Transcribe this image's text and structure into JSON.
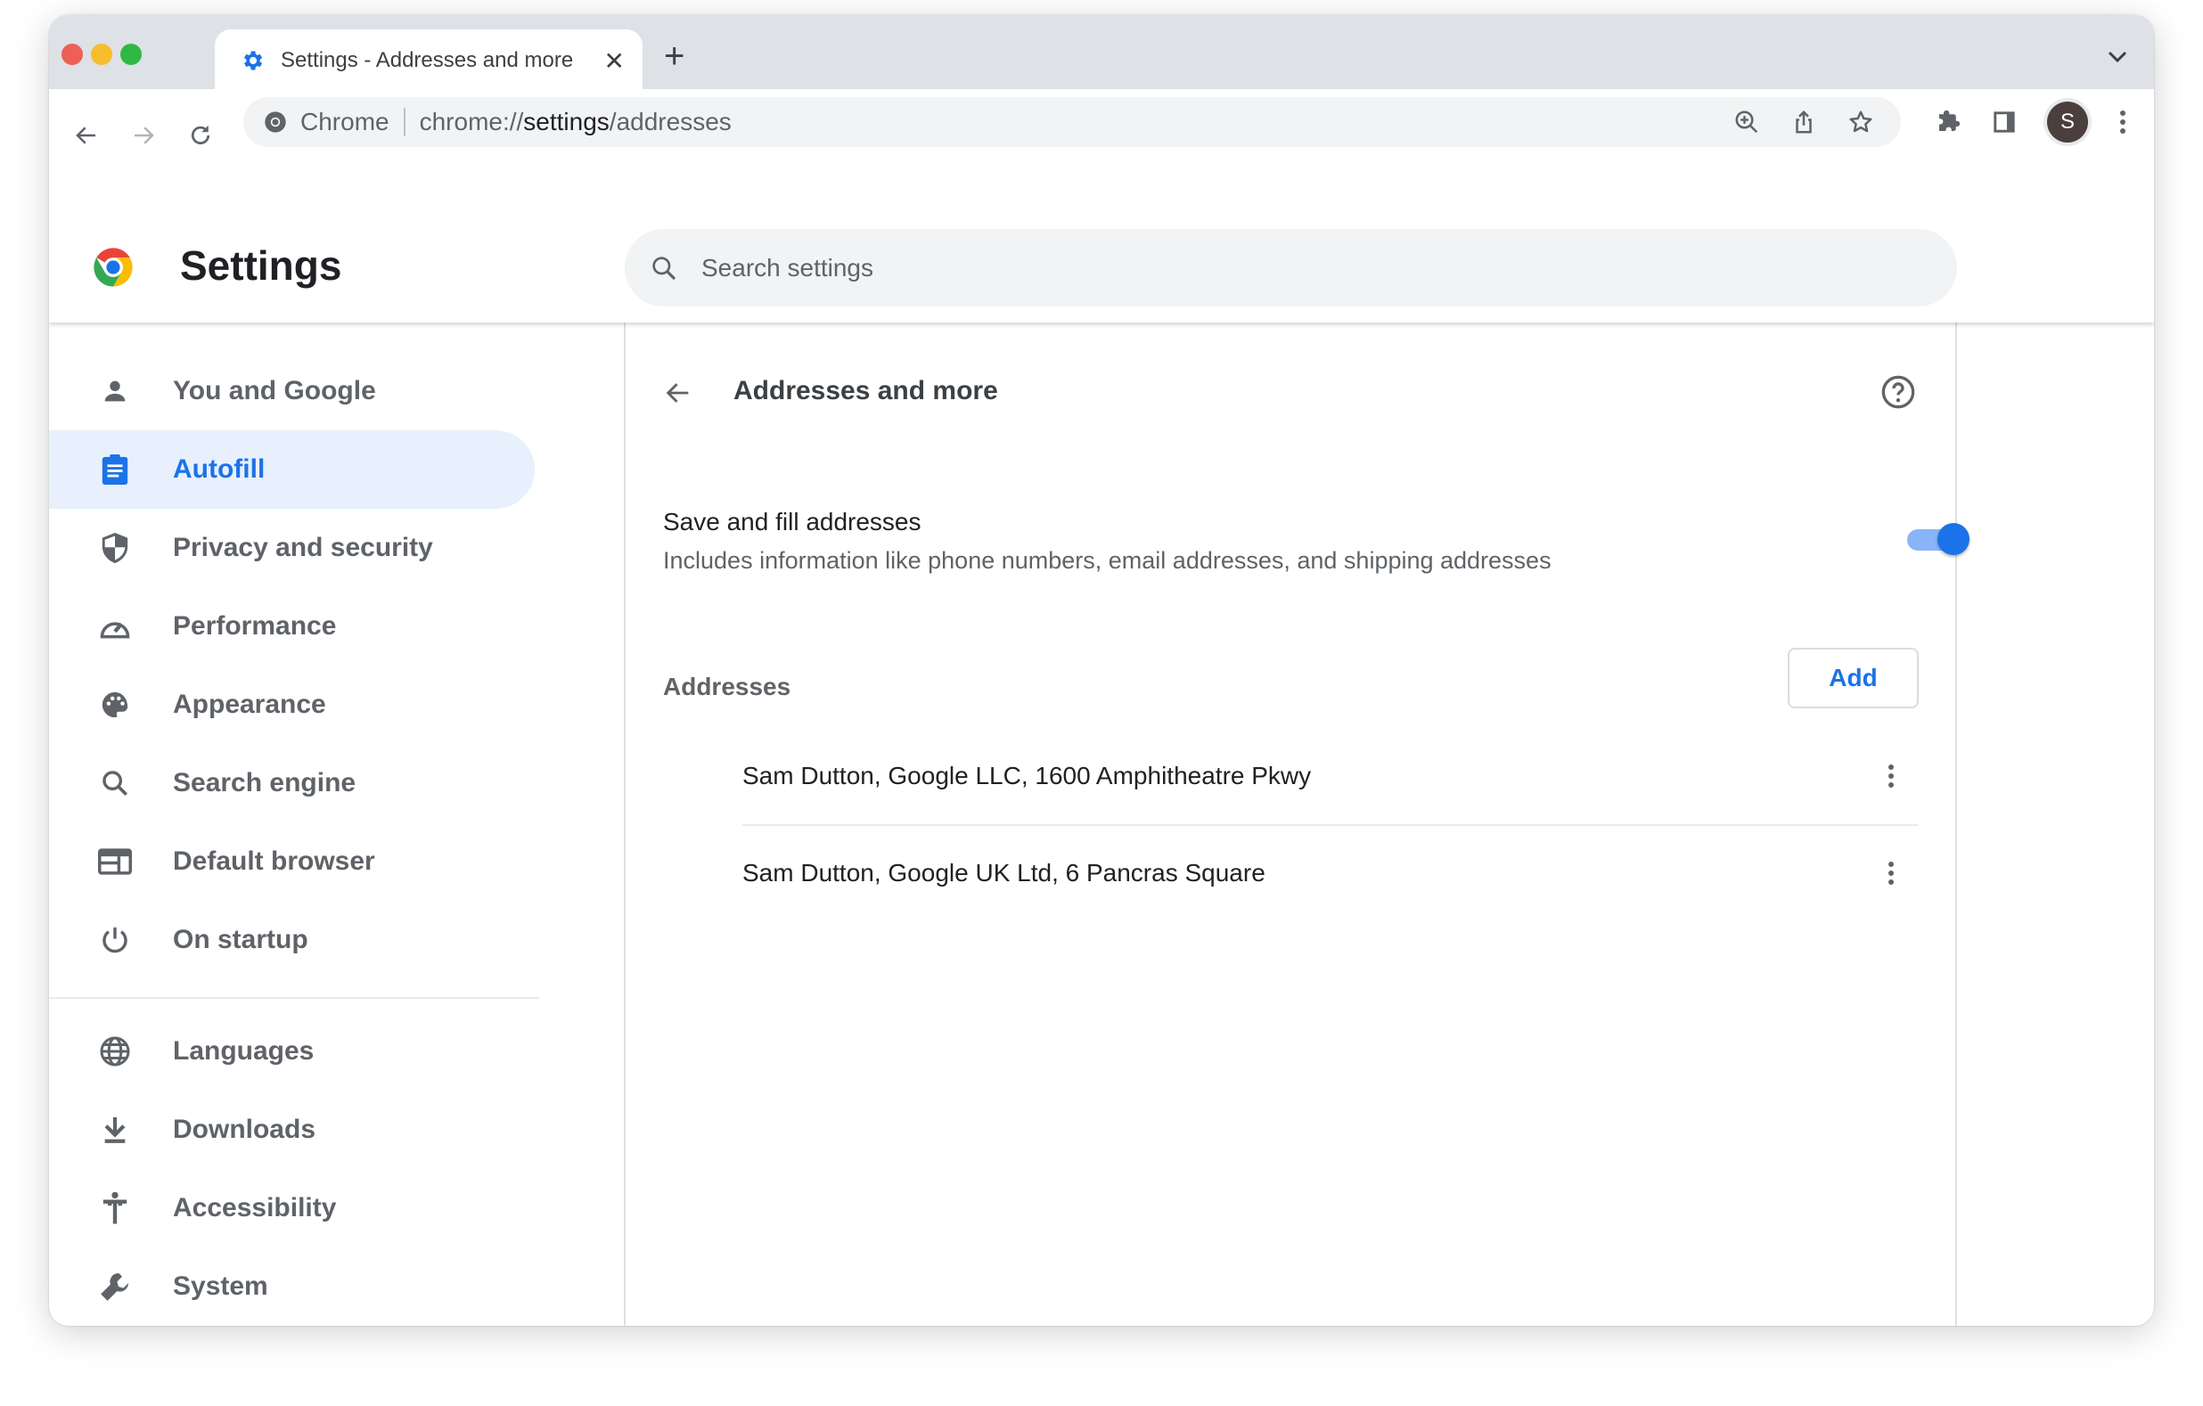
{
  "browser": {
    "tab_title": "Settings - Addresses and more",
    "tab_icon": "gear-icon",
    "omnibox_chip": "Chrome",
    "url_scheme": "chrome://",
    "url_host": "settings",
    "url_path": "/addresses",
    "profile_initial": "S"
  },
  "header": {
    "title": "Settings",
    "search_placeholder": "Search settings"
  },
  "sidebar": {
    "items": [
      {
        "label": "You and Google",
        "icon": "person-icon"
      },
      {
        "label": "Autofill",
        "icon": "clipboard-icon",
        "active": true
      },
      {
        "label": "Privacy and security",
        "icon": "shield-icon"
      },
      {
        "label": "Performance",
        "icon": "speedometer-icon"
      },
      {
        "label": "Appearance",
        "icon": "palette-icon"
      },
      {
        "label": "Search engine",
        "icon": "search-icon"
      },
      {
        "label": "Default browser",
        "icon": "browser-icon"
      },
      {
        "label": "On startup",
        "icon": "power-icon"
      },
      {
        "label": "Languages",
        "icon": "globe-icon"
      },
      {
        "label": "Downloads",
        "icon": "download-icon"
      },
      {
        "label": "Accessibility",
        "icon": "accessibility-icon"
      },
      {
        "label": "System",
        "icon": "wrench-icon"
      }
    ]
  },
  "main": {
    "title": "Addresses and more",
    "save_fill": {
      "label": "Save and fill addresses",
      "description": "Includes information like phone numbers, email addresses, and shipping addresses",
      "enabled": true
    },
    "addresses_label": "Addresses",
    "add_label": "Add",
    "addresses": [
      "Sam Dutton, Google LLC, 1600 Amphitheatre Pkwy",
      "Sam Dutton, Google UK Ltd, 6 Pancras Square"
    ]
  },
  "colors": {
    "accent": "#1a73e8",
    "active_bg": "#e8f0fe",
    "tabstrip": "#dee1e6",
    "icon": "#5f6368"
  }
}
